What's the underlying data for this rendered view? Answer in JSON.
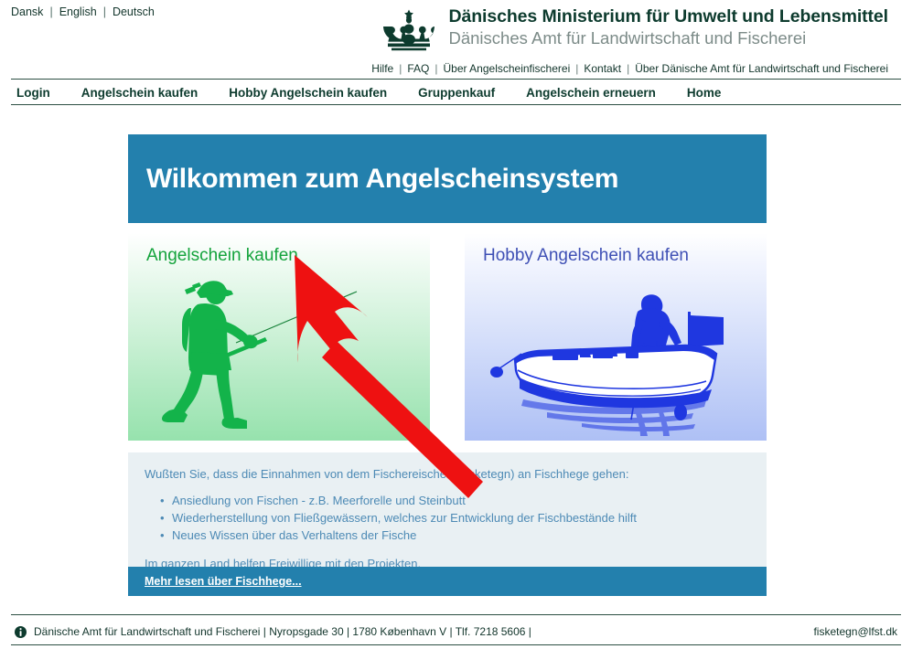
{
  "language_bar": {
    "items": [
      {
        "label": "Dansk"
      },
      {
        "label": "English"
      },
      {
        "label": "Deutsch"
      }
    ],
    "separator": "|"
  },
  "masthead": {
    "crown_icon": "danish-crown-icon",
    "title": "Dänisches Ministerium für Umwelt und Lebensmittel",
    "subtitle": "Dänisches Amt für Landwirtschaft und Fischerei"
  },
  "sub_links": {
    "separator": "|",
    "items": [
      {
        "label": "Hilfe"
      },
      {
        "label": "FAQ"
      },
      {
        "label": "Über Angelscheinfischerei"
      },
      {
        "label": "Kontakt"
      },
      {
        "label": "Über Dänische Amt für Landwirtschaft und Fischerei"
      }
    ]
  },
  "main_nav": {
    "items": [
      {
        "label": "Login"
      },
      {
        "label": "Angelschein kaufen"
      },
      {
        "label": "Hobby Angelschein kaufen"
      },
      {
        "label": "Gruppenkauf"
      },
      {
        "label": "Angelschein erneuern"
      },
      {
        "label": "Home"
      }
    ]
  },
  "banner": {
    "title": "Wilkommen zum Angelscheinsystem"
  },
  "cards": [
    {
      "title": "Angelschein kaufen",
      "art": "fisherman-silhouette-illustration",
      "accent": "#14a33c"
    },
    {
      "title": "Hobby Angelschein kaufen",
      "art": "fishing-boat-illustration",
      "accent": "#3f50b5"
    }
  ],
  "annotation": {
    "arrow": "red-pointer-arrow",
    "color": "#ee1111",
    "points_at": "Angelschein kaufen"
  },
  "infobox": {
    "lead": "Wußten Sie, dass die Einnahmen von dem Fischereischein (fisketegn) an Fischhege gehen:",
    "bullets": [
      "Ansiedlung von Fischen - z.B. Meerforelle und Steinbutt",
      "Wiederherstellung von Fließgewässern, welches zur Entwicklung der Fischbestände hilft",
      "Neues Wissen über das Verhaltens der Fische"
    ],
    "footer_text": "Im ganzen Land helfen Freiwillige mit den Projekten.",
    "read_more": "Mehr lesen über Fischhege...",
    "background": "#e9f0f3",
    "text_color": "#4d8ab5",
    "bar_color": "#2380ad"
  },
  "footer": {
    "icon": "info-circle-icon",
    "left_text": "Dänische Amt für Landwirtschaft und Fischerei | Nyropsgade 30 | 1780 København V | Tlf. 7218 5606 |",
    "email": "fisketegn@lfst.dk"
  }
}
